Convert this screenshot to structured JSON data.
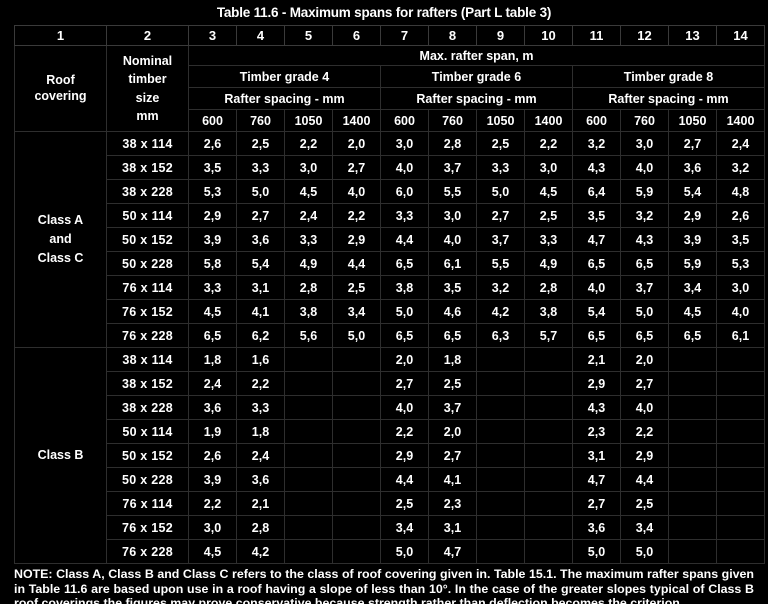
{
  "title": "Table 11.6 - Maximum spans for rafters (Part L table 3)",
  "column_numbers": [
    "1",
    "2",
    "3",
    "4",
    "5",
    "6",
    "7",
    "8",
    "9",
    "10",
    "11",
    "12",
    "13",
    "14"
  ],
  "header": {
    "roof_covering": "Roof covering",
    "nominal_timber_size": "Nominal timber size mm",
    "nominal_lines": [
      "Nominal",
      "timber",
      "size",
      "mm"
    ],
    "max_rafter_span": "Max. rafter span, m",
    "grades": [
      "Timber grade 4",
      "Timber grade 6",
      "Timber grade 8"
    ],
    "rafter_spacing_label": "Rafter spacing - mm",
    "spacings": [
      "600",
      "760",
      "1050",
      "1400"
    ]
  },
  "note": "NOTE: Class A, Class B and Class C refers to the class of roof covering given in. Table 15.1. The maximum rafter spans given in Table 11.6 are based upon use in a roof having a slope of less than 10°. In the case of the greater slopes typical of Class B roof coverings the figures may prove conservative because strength rather than deflection becomes the criterion.",
  "colors": {
    "header_green": "#5cb860",
    "background": "#000000",
    "text": "#ffffff",
    "class_cell_bg": "#f0f0f0",
    "class_cell_text": "#101010"
  },
  "chart_data": {
    "type": "table",
    "title": "Table 11.6 - Maximum spans for rafters (Part L table 3)",
    "columns": [
      "Roof covering",
      "Nominal timber size mm",
      "Grade 4 / 600",
      "Grade 4 / 760",
      "Grade 4 / 1050",
      "Grade 4 / 1400",
      "Grade 6 / 600",
      "Grade 6 / 760",
      "Grade 6 / 1050",
      "Grade 6 / 1400",
      "Grade 8 / 600",
      "Grade 8 / 760",
      "Grade 8 / 1050",
      "Grade 8 / 1400"
    ],
    "units": "m",
    "groups": [
      {
        "class_label": "Class A and Class C",
        "class_lines": [
          "Class A",
          "and",
          "Class C"
        ],
        "rows": [
          {
            "size": "38 x 114",
            "values": [
              "2,6",
              "2,5",
              "2,2",
              "2,0",
              "3,0",
              "2,8",
              "2,5",
              "2,2",
              "3,2",
              "3,0",
              "2,7",
              "2,4"
            ],
            "group_start": true
          },
          {
            "size": "38 x 152",
            "values": [
              "3,5",
              "3,3",
              "3,0",
              "2,7",
              "4,0",
              "3,7",
              "3,3",
              "3,0",
              "4,3",
              "4,0",
              "3,6",
              "3,2"
            ],
            "group_start": false
          },
          {
            "size": "38 x 228",
            "values": [
              "5,3",
              "5,0",
              "4,5",
              "4,0",
              "6,0",
              "5,5",
              "5,0",
              "4,5",
              "6,4",
              "5,9",
              "5,4",
              "4,8"
            ],
            "group_start": false
          },
          {
            "size": "50 x 114",
            "values": [
              "2,9",
              "2,7",
              "2,4",
              "2,2",
              "3,3",
              "3,0",
              "2,7",
              "2,5",
              "3,5",
              "3,2",
              "2,9",
              "2,6"
            ],
            "group_start": true
          },
          {
            "size": "50 x 152",
            "values": [
              "3,9",
              "3,6",
              "3,3",
              "2,9",
              "4,4",
              "4,0",
              "3,7",
              "3,3",
              "4,7",
              "4,3",
              "3,9",
              "3,5"
            ],
            "group_start": false
          },
          {
            "size": "50 x 228",
            "values": [
              "5,8",
              "5,4",
              "4,9",
              "4,4",
              "6,5",
              "6,1",
              "5,5",
              "4,9",
              "6,5",
              "6,5",
              "5,9",
              "5,3"
            ],
            "group_start": false
          },
          {
            "size": "76 x 114",
            "values": [
              "3,3",
              "3,1",
              "2,8",
              "2,5",
              "3,8",
              "3,5",
              "3,2",
              "2,8",
              "4,0",
              "3,7",
              "3,4",
              "3,0"
            ],
            "group_start": true
          },
          {
            "size": "76 x 152",
            "values": [
              "4,5",
              "4,1",
              "3,8",
              "3,4",
              "5,0",
              "4,6",
              "4,2",
              "3,8",
              "5,4",
              "5,0",
              "4,5",
              "4,0"
            ],
            "group_start": false
          },
          {
            "size": "76 x 228",
            "values": [
              "6,5",
              "6,2",
              "5,6",
              "5,0",
              "6,5",
              "6,5",
              "6,3",
              "5,7",
              "6,5",
              "6,5",
              "6,5",
              "6,1"
            ],
            "group_start": false
          }
        ]
      },
      {
        "class_label": "Class B",
        "class_lines": [
          "Class B"
        ],
        "rows": [
          {
            "size": "38 x 114",
            "values": [
              "1,8",
              "1,6",
              "",
              "",
              "2,0",
              "1,8",
              "",
              "",
              "2,1",
              "2,0",
              "",
              ""
            ],
            "group_start": true
          },
          {
            "size": "38 x 152",
            "values": [
              "2,4",
              "2,2",
              "",
              "",
              "2,7",
              "2,5",
              "",
              "",
              "2,9",
              "2,7",
              "",
              ""
            ],
            "group_start": false
          },
          {
            "size": "38 x 228",
            "values": [
              "3,6",
              "3,3",
              "",
              "",
              "4,0",
              "3,7",
              "",
              "",
              "4,3",
              "4,0",
              "",
              ""
            ],
            "group_start": false
          },
          {
            "size": "50 x 114",
            "values": [
              "1,9",
              "1,8",
              "",
              "",
              "2,2",
              "2,0",
              "",
              "",
              "2,3",
              "2,2",
              "",
              ""
            ],
            "group_start": true
          },
          {
            "size": "50 x 152",
            "values": [
              "2,6",
              "2,4",
              "",
              "",
              "2,9",
              "2,7",
              "",
              "",
              "3,1",
              "2,9",
              "",
              ""
            ],
            "group_start": false
          },
          {
            "size": "50 x 228",
            "values": [
              "3,9",
              "3,6",
              "",
              "",
              "4,4",
              "4,1",
              "",
              "",
              "4,7",
              "4,4",
              "",
              ""
            ],
            "group_start": false
          },
          {
            "size": "76 x 114",
            "values": [
              "2,2",
              "2,1",
              "",
              "",
              "2,5",
              "2,3",
              "",
              "",
              "2,7",
              "2,5",
              "",
              ""
            ],
            "group_start": true
          },
          {
            "size": "76 x 152",
            "values": [
              "3,0",
              "2,8",
              "",
              "",
              "3,4",
              "3,1",
              "",
              "",
              "3,6",
              "3,4",
              "",
              ""
            ],
            "group_start": false
          },
          {
            "size": "76 x 228",
            "values": [
              "4,5",
              "4,2",
              "",
              "",
              "5,0",
              "4,7",
              "",
              "",
              "5,0",
              "5,0",
              "",
              ""
            ],
            "group_start": false
          }
        ]
      }
    ]
  }
}
